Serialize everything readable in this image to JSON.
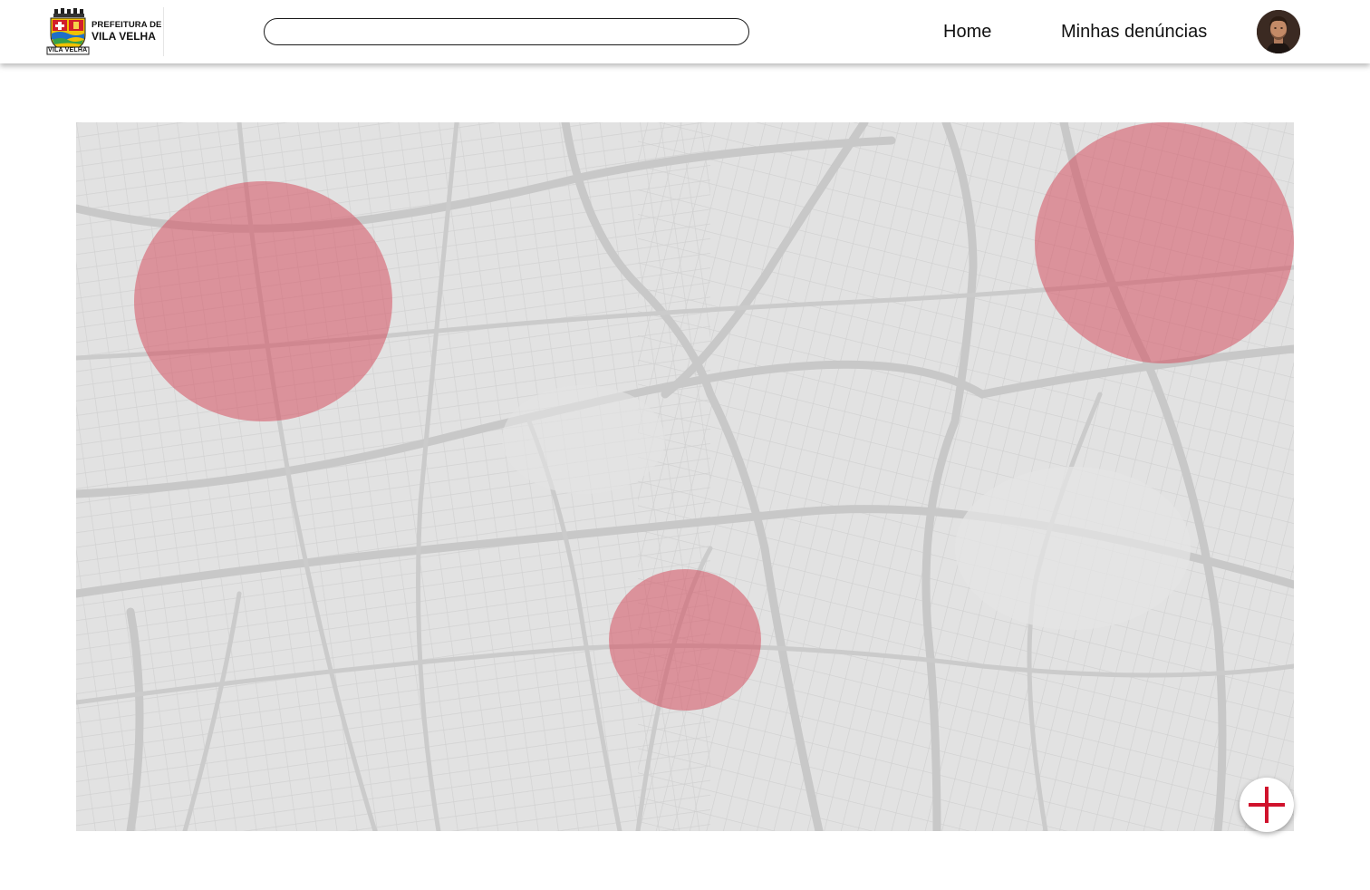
{
  "header": {
    "logo": {
      "line1": "PREFEITURA DE",
      "line2": "VILA VELHA",
      "caption": "VILA VELHA",
      "icon": "city-coat-of-arms-logo"
    },
    "search": {
      "value": "",
      "placeholder": ""
    },
    "nav": {
      "home_label": "Home",
      "my_reports_label": "Minhas denúncias"
    },
    "avatar": {
      "icon": "user-avatar-photo"
    }
  },
  "map": {
    "background_color": "#e2e2e2",
    "road_color": "#c9c9c9",
    "zone_color": "#d65060",
    "zone_count": 3
  },
  "fab": {
    "icon": "plus-icon",
    "color": "#d0122c"
  }
}
